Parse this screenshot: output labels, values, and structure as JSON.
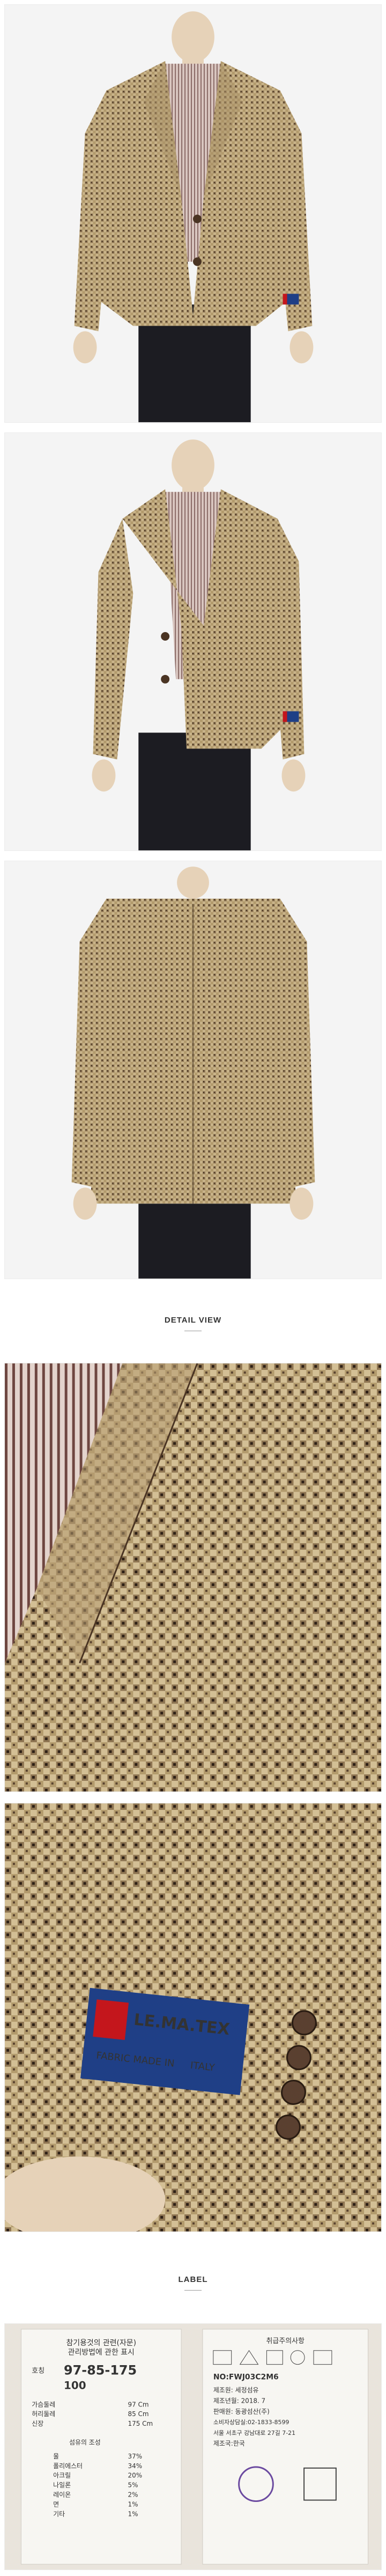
{
  "sections": {
    "detail_title": "DETAIL VIEW",
    "label_title": "LABEL"
  },
  "photos": [
    {
      "name": "front-view",
      "caption": ""
    },
    {
      "name": "angled-view",
      "caption": ""
    },
    {
      "name": "back-view",
      "caption": ""
    },
    {
      "name": "lapel-closeup",
      "caption": ""
    },
    {
      "name": "cuff-closeup",
      "caption": ""
    }
  ],
  "brand_tag": {
    "line1": "LE.MA.TEX",
    "line2": "FABRIC MADE IN",
    "line3": "ITALY"
  },
  "label_left": {
    "title1": "참기용것의 관련(자문)",
    "title2": "관리방법에 관한 표시",
    "size_label": "호칭",
    "size": "97-85-175",
    "size2": "100",
    "rows": [
      {
        "k": "가슴둘레",
        "v": "97 Cm"
      },
      {
        "k": "허리둘레",
        "v": "85 Cm"
      },
      {
        "k": "신장",
        "v": "175 Cm"
      }
    ],
    "fabric_title": "섬유의 조성",
    "materials": [
      {
        "k": "울",
        "v": "37%"
      },
      {
        "k": "폴리에스터",
        "v": "34%"
      },
      {
        "k": "아크릴",
        "v": "20%"
      },
      {
        "k": "나일론",
        "v": "5%"
      },
      {
        "k": "레이온",
        "v": "2%"
      },
      {
        "k": "면",
        "v": "1%"
      },
      {
        "k": "기타",
        "v": "1%"
      }
    ]
  },
  "label_right": {
    "header": "취급주의사항",
    "model": "NO:FWJ03C2M6",
    "lines": [
      "제조원: 세정섬유",
      "제조년월: 2018. 7",
      "판매원: 동광섬산(주)",
      "소비자상담실:02-1833-8599",
      "서울 서초구 강남대로 27길 7-21",
      "제조국:한국"
    ]
  },
  "colors": {
    "tweed_light": "#c9b48a",
    "tweed_mid": "#8e7552",
    "tweed_dark": "#3b2a1c",
    "shirt": "#b89a94",
    "trousers": "#1c1c22",
    "mannequin": "#e6d2b8",
    "tag_blue": "#1f3f86",
    "tag_red": "#c4161c"
  }
}
